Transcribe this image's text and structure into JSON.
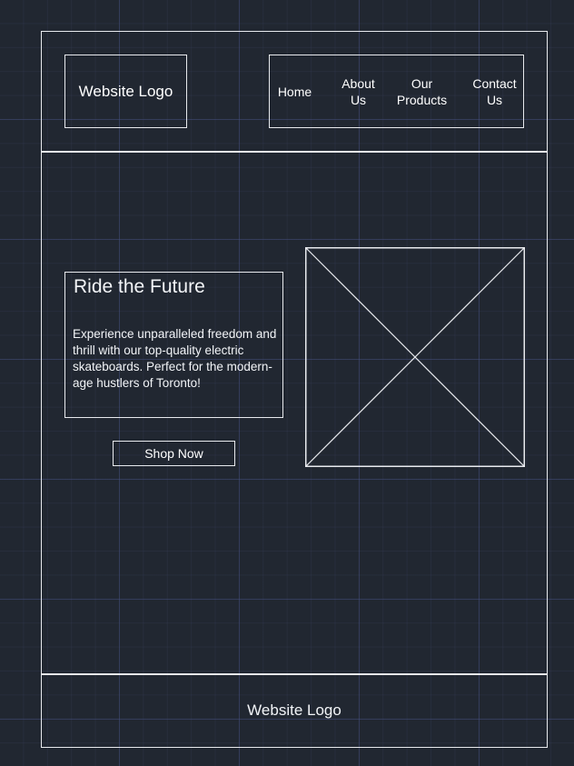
{
  "header": {
    "logo_text": "Website Logo",
    "nav": [
      {
        "label": "Home"
      },
      {
        "label": "About\nUs"
      },
      {
        "label": "Our\nProducts"
      },
      {
        "label": "Contact\nUs"
      }
    ]
  },
  "hero": {
    "title": "Ride the Future",
    "description": "Experience unparalleled freedom and thrill with our top-quality electric skateboards. Perfect for the modern-age hustlers of Toronto!",
    "cta_label": "Shop Now"
  },
  "footer": {
    "logo_text": "Website Logo"
  },
  "colors": {
    "background": "#212731",
    "stroke": "#e8eaee",
    "grid": "#464f82"
  }
}
